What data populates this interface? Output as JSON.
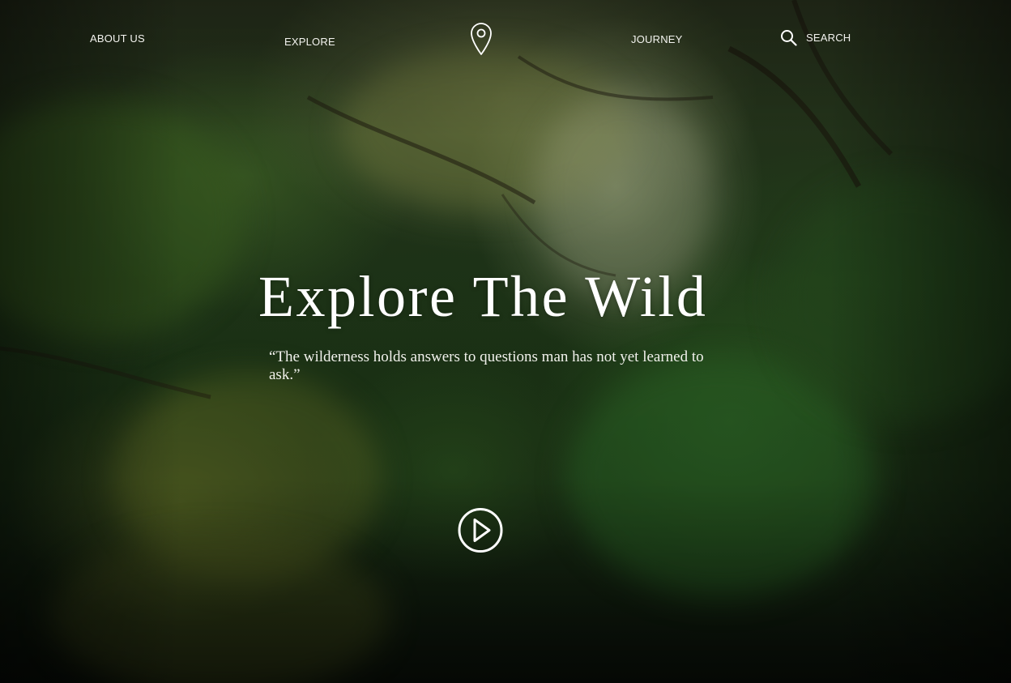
{
  "nav": {
    "about_label": "ABOUT US",
    "explore_label": "EXPLORE",
    "journey_label": "JOURNEY",
    "search_label": "SEARCH",
    "logo_icon": "map-pin-icon",
    "search_icon": "search-icon"
  },
  "hero": {
    "title": "Explore The Wild",
    "quote": "“The wilderness holds answers to questions man has not yet learned to ask.”",
    "play_icon": "play-circle-icon"
  },
  "colors": {
    "text": "#ffffff",
    "forest_dark": "#1b3215",
    "forest_light": "#4f7a2c"
  }
}
